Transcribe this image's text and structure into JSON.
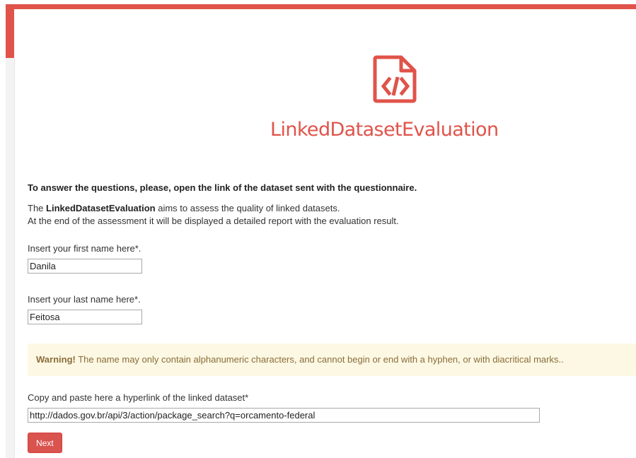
{
  "header": {
    "app_title": "LinkedDatasetEvaluation",
    "logo_icon": "file-code-icon",
    "accent_color": "#e0534a"
  },
  "intro": {
    "instruction": "To answer the questions, please, open the link of the dataset sent with the questionnaire.",
    "line1_prefix": "The ",
    "line1_bold": "LinkedDatasetEvaluation",
    "line1_suffix": " aims to assess the quality of linked datasets.",
    "line2": "At the end of the assessment it will be displayed a detailed report with the evaluation result."
  },
  "form": {
    "first_name": {
      "label": "Insert your first name here*.",
      "value": "Danila"
    },
    "last_name": {
      "label": "Insert your last name here*.",
      "value": "Feitosa"
    },
    "warning": {
      "bold": "Warning!",
      "text": " The name may only contain alphanumeric characters, and cannot begin or end with a hyphen, or with diacritical marks..",
      "background": "#fcf8e3",
      "color": "#8a6d3b"
    },
    "dataset_link": {
      "label": "Copy and paste here a hyperlink of the linked dataset*",
      "value": "http://dados.gov.br/api/3/action/package_search?q=orcamento-federal"
    },
    "next_label": "Next",
    "next_color": "#d9534f"
  }
}
